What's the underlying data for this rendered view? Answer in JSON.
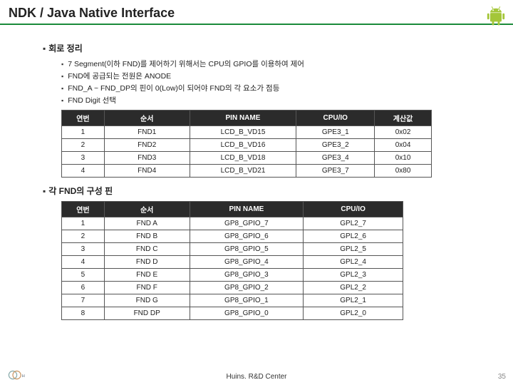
{
  "title": "NDK / Java Native Interface",
  "section1": {
    "heading": "회로 정리",
    "bullets": [
      "7 Segment(이하 FND)를 제어하기 위해서는 CPU의 GPIO를 이용하여 제어",
      "FND에 공급되는 전원은 ANODE",
      "FND_A ~ FND_DP의 핀이 0(Low)이 되어야 FND의 각 요소가 점등",
      "FND Digit 선택"
    ]
  },
  "table1": {
    "headers": [
      "연번",
      "순서",
      "PIN NAME",
      "CPU/IO",
      "계산값"
    ],
    "rows": [
      [
        "1",
        "FND1",
        "LCD_B_VD15",
        "GPE3_1",
        "0x02"
      ],
      [
        "2",
        "FND2",
        "LCD_B_VD16",
        "GPE3_2",
        "0x04"
      ],
      [
        "3",
        "FND3",
        "LCD_B_VD18",
        "GPE3_4",
        "0x10"
      ],
      [
        "4",
        "FND4",
        "LCD_B_VD21",
        "GPE3_7",
        "0x80"
      ]
    ]
  },
  "section2": {
    "heading": "각 FND의 구성 핀"
  },
  "table2": {
    "headers": [
      "연번",
      "순서",
      "PIN NAME",
      "CPU/IO"
    ],
    "rows": [
      [
        "1",
        "FND A",
        "GP8_GPIO_7",
        "GPL2_7"
      ],
      [
        "2",
        "FND B",
        "GP8_GPIO_6",
        "GPL2_6"
      ],
      [
        "3",
        "FND C",
        "GP8_GPIO_5",
        "GPL2_5"
      ],
      [
        "4",
        "FND D",
        "GP8_GPIO_4",
        "GPL2_4"
      ],
      [
        "5",
        "FND E",
        "GP8_GPIO_3",
        "GPL2_3"
      ],
      [
        "6",
        "FND F",
        "GP8_GPIO_2",
        "GPL2_2"
      ],
      [
        "7",
        "FND G",
        "GP8_GPIO_1",
        "GPL2_1"
      ],
      [
        "8",
        "FND DP",
        "GP8_GPIO_0",
        "GPL2_0"
      ]
    ]
  },
  "footer": {
    "center": "Huins. R&D Center",
    "page": "35"
  }
}
